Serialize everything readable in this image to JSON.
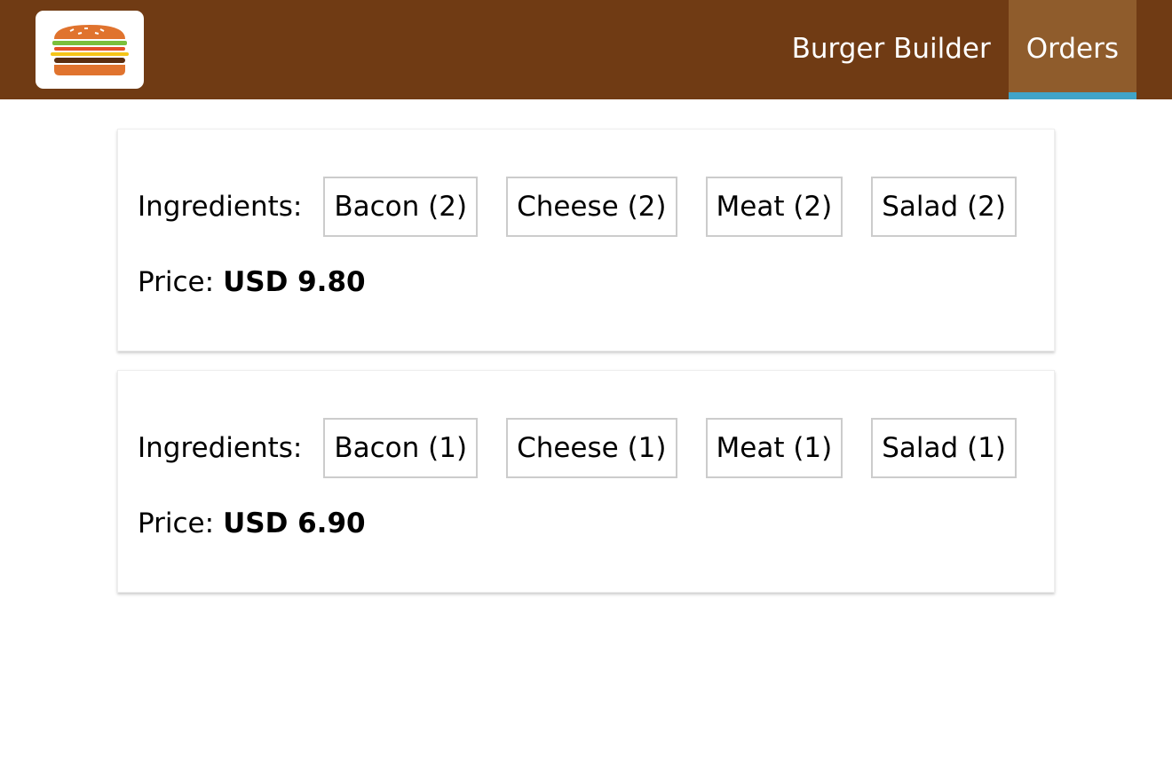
{
  "header": {
    "logo_icon": "burger-logo-icon",
    "colors": {
      "toolbar": "#703b14",
      "active_tab": "#8f5c2c",
      "active_indicator": "#40a4c8"
    },
    "nav": [
      {
        "label": "Burger Builder",
        "active": false
      },
      {
        "label": "Orders",
        "active": true
      }
    ]
  },
  "orders": [
    {
      "ingredients_label": "Ingredients:",
      "ingredients": [
        "Bacon (2)",
        "Cheese (2)",
        "Meat (2)",
        "Salad (2)"
      ],
      "price_label": "Price:",
      "price": "USD 9.80"
    },
    {
      "ingredients_label": "Ingredients:",
      "ingredients": [
        "Bacon (1)",
        "Cheese (1)",
        "Meat (1)",
        "Salad (1)"
      ],
      "price_label": "Price:",
      "price": "USD 6.90"
    }
  ]
}
